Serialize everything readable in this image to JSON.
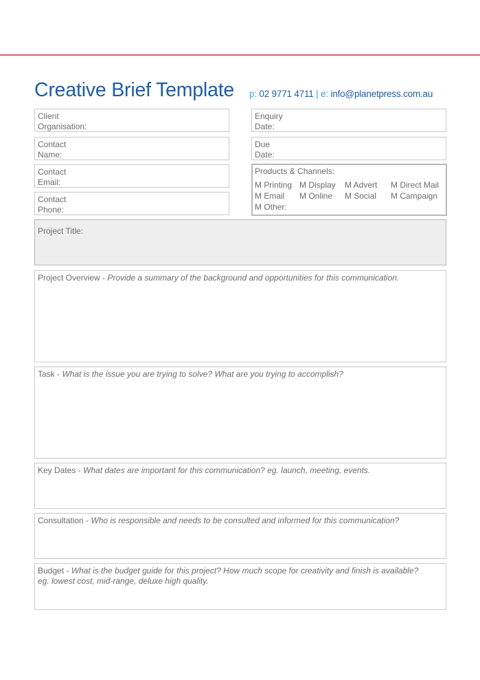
{
  "header": {
    "title": "Creative Brief Template",
    "phone_label": "p:",
    "phone_value": "02 9771 4711",
    "separator": "|",
    "email_label": "e:",
    "email_value": "info@planetpress.com.au"
  },
  "colors": {
    "title": "#1d5ea6",
    "label_accent": "#3ba3d6",
    "top_rule": "#e06060",
    "shaded_box": "#eeeeee"
  },
  "left_fields": [
    {
      "line1": "Client",
      "line2": "Organisation:"
    },
    {
      "line1": "Contact",
      "line2": "Name:"
    },
    {
      "line1": "Contact",
      "line2": "Email:"
    },
    {
      "line1": "Contact",
      "line2": "Phone:"
    }
  ],
  "right_fields": [
    {
      "line1": "Enquiry",
      "line2": "Date:"
    },
    {
      "line1": "Due",
      "line2": "Date:"
    }
  ],
  "products": {
    "heading": "Products & Channels:",
    "options": [
      "M Printing",
      "M Display",
      "M Advert",
      "M Direct Mail",
      "M Email",
      "M Online",
      "M Social",
      "M Campaign",
      "M Other:"
    ]
  },
  "project_title": {
    "label": "Project Title:"
  },
  "sections": [
    {
      "label": "Project Overview - ",
      "hint": "Provide a summary of the background and opportunities for this communication."
    },
    {
      "label": "Task - ",
      "hint": "What is the issue you are trying to solve? What are you trying to accomplish?"
    },
    {
      "label": "Key Dates - ",
      "hint": "What dates are important for this communication? eg. launch, meeting, events."
    },
    {
      "label": "Consultation - ",
      "hint": "Who is responsible and needs to be consulted and informed for this communication?"
    },
    {
      "label": "Budget - ",
      "hint": "What is the budget guide for this project? How much scope for creativity and finish is available?",
      "hint2": "eg. lowest cost, mid-range, deluxe high quality."
    }
  ]
}
